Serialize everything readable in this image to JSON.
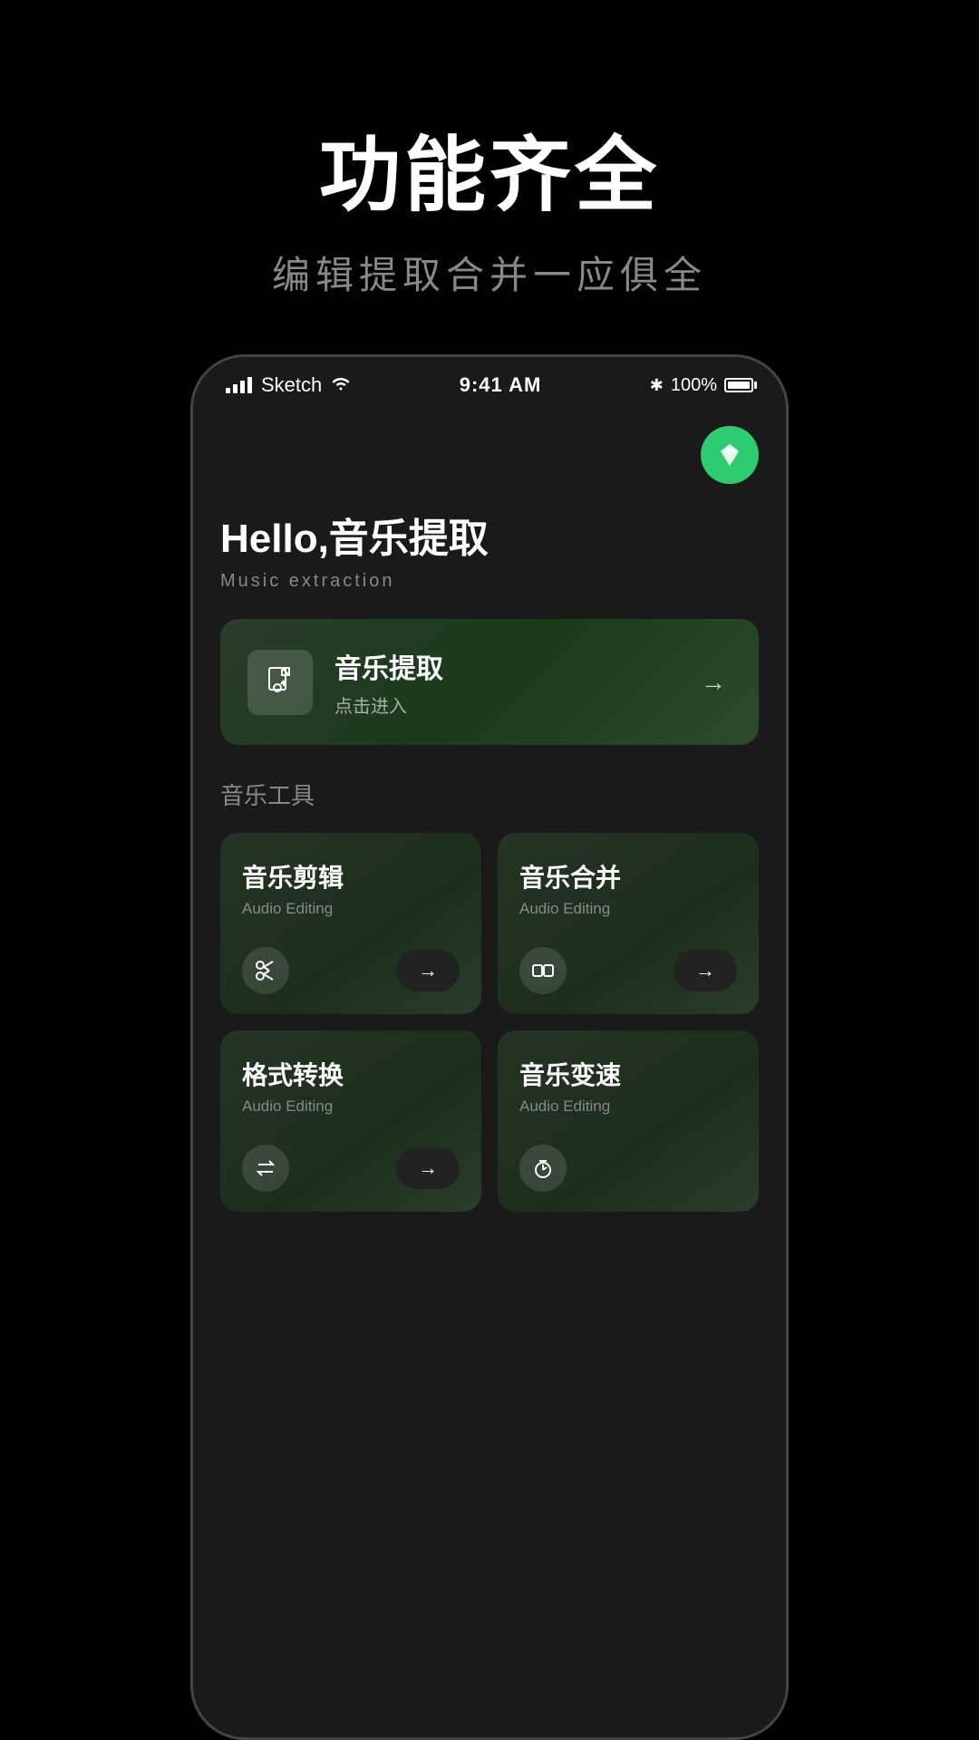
{
  "page": {
    "background": "#000000",
    "title": "功能齐全",
    "subtitle": "编辑提取合并一应俱全"
  },
  "status_bar": {
    "carrier": "Sketch",
    "time": "9:41 AM",
    "battery": "100%"
  },
  "app": {
    "vip_icon": "◆",
    "hello_title": "Hello,音乐提取",
    "hello_subtitle": "Music extraction",
    "extract_card": {
      "title": "音乐提取",
      "subtitle": "点击进入",
      "arrow": "→"
    },
    "tools_section_title": "音乐工具",
    "tools": [
      {
        "title": "音乐剪辑",
        "subtitle": "Audio Editing",
        "icon": "scissors"
      },
      {
        "title": "音乐合并",
        "subtitle": "Audio Editing",
        "icon": "merge"
      },
      {
        "title": "格式转换",
        "subtitle": "Audio Editing",
        "icon": "convert"
      },
      {
        "title": "音乐变速",
        "subtitle": "Audio Editing",
        "icon": "speed"
      }
    ]
  }
}
